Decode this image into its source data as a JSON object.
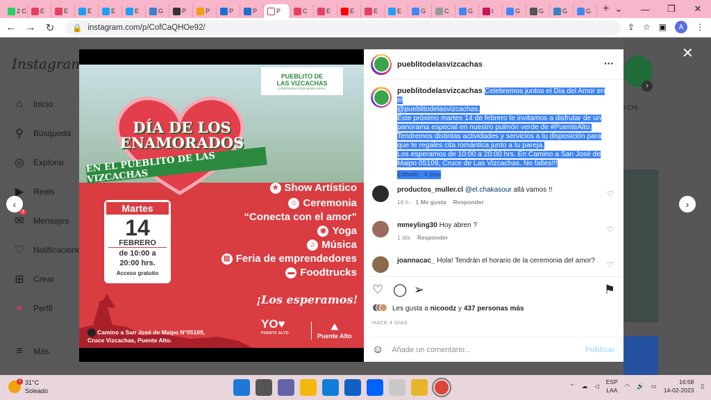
{
  "browser": {
    "tabs": [
      {
        "label": "2 C",
        "color": "#25d366"
      },
      {
        "label": "E",
        "color": "#e4405f"
      },
      {
        "label": "E",
        "color": "#e4405f"
      },
      {
        "label": "E",
        "color": "#1da1f2"
      },
      {
        "label": "E",
        "color": "#1da1f2"
      },
      {
        "label": "E",
        "color": "#1da1f2"
      },
      {
        "label": "G",
        "color": "#3b82c4"
      },
      {
        "label": "P",
        "color": "#333333"
      },
      {
        "label": "P",
        "color": "#f2a10c"
      },
      {
        "label": "P",
        "color": "#1a6fd0"
      },
      {
        "label": "P",
        "color": "#1a6fd0"
      },
      {
        "label": "P",
        "color": "#ffffff",
        "active": true
      },
      {
        "label": "C",
        "color": "#e4405f"
      },
      {
        "label": "E",
        "color": "#e4405f"
      },
      {
        "label": "E",
        "color": "#ff0000"
      },
      {
        "label": "E",
        "color": "#e4405f"
      },
      {
        "label": "E",
        "color": "#1da1f2"
      },
      {
        "label": "G",
        "color": "#4285f4"
      },
      {
        "label": "C",
        "color": "#999999"
      },
      {
        "label": "G",
        "color": "#4285f4"
      },
      {
        "label": "I",
        "color": "#c2185b"
      },
      {
        "label": "G",
        "color": "#4285f4"
      },
      {
        "label": "G",
        "color": "#555555"
      },
      {
        "label": "G",
        "color": "#3b82c4"
      },
      {
        "label": "G",
        "color": "#4285f4"
      }
    ],
    "url": "instagram.com/p/CofCaQHOe92/",
    "profile_initial": "A"
  },
  "sidebar": {
    "brand": "Instagram",
    "items": [
      {
        "label": "Inicio",
        "icon": "home-icon"
      },
      {
        "label": "Búsqueda",
        "icon": "search-icon"
      },
      {
        "label": "Explorar",
        "icon": "compass-icon"
      },
      {
        "label": "Reels",
        "icon": "reels-icon"
      },
      {
        "label": "Mensajes",
        "icon": "messenger-icon"
      },
      {
        "label": "Notificaciones",
        "icon": "heart-icon"
      },
      {
        "label": "Crear",
        "icon": "plus-square-icon"
      },
      {
        "label": "Perfil",
        "icon": "profile-icon"
      },
      {
        "label": "Más",
        "icon": "menu-icon"
      }
    ],
    "messages_badge": "3"
  },
  "poster": {
    "logo_line1": "PUEBLITO DE",
    "logo_line2": "LAS VIZCACHAS",
    "logo_line3": "CORPORACIÓN MUNICIPAL",
    "title": "DÍA DE LOS ENAMORADOS",
    "ribbon": "EN EL PUEBLITO DE LAS VIZCACHAS",
    "events": [
      "Show Artístico",
      "Ceremonia",
      "“Conecta con el amor”",
      "Yoga",
      "Música",
      "Feria de emprendedores",
      "Foodtrucks"
    ],
    "cal_head": "Martes",
    "cal_day": "14",
    "cal_month": "FEBRERO",
    "cal_time1": "de 10:00 a",
    "cal_time2": "20:00 hrs.",
    "cal_free": "Acceso gratuito",
    "esperamos": "¡Los esperamos!",
    "addr1": "Camino a San José de Maipo N°05109,",
    "addr2": "Cruce Vizcachas, Puente Alto.",
    "yo": "YO♥",
    "yo_sub": "PUENTE ALTO",
    "pa": "Puente Alto"
  },
  "post": {
    "username": "pueblitodelasvizcachas",
    "caption_l1": "Celebremos juntos el Día del Amor en el",
    "caption_l2": "@pueblitodelasvizcachas.",
    "caption_l3": "Este próximo martes 14 de febrero te invitamos a disfrutar de un",
    "caption_l4": "panorama especial en nuestro pulmón verde de #PuenteAlto.",
    "caption_l5": "Tendremos distintas actividades y servicios a tu disposición para",
    "caption_l6": "que te regales cita romántica junto a tu pareja.",
    "caption_l7": "Los esperamos de 10:00 a 20:00 hrs. En Camino a San José de",
    "caption_l8": "Maipo 05109, Cruce de Las Vizcachas. No faltes!!!",
    "edited": "Editado · 4 días",
    "comments": [
      {
        "user": "productos_muller.cl",
        "mention": "@el.chakasour",
        "text": " allá vamos !!",
        "time": "16 h",
        "likes": "1 Me gusta",
        "reply": "Responder",
        "color": "#2a2a2a"
      },
      {
        "user": "mmeyling30",
        "text": "Hoy abren ?",
        "time": "1 día",
        "reply": "Responder",
        "color": "#9a6b5d"
      },
      {
        "user": "joannacac_",
        "text": "Hola! Tendrán el horario de la ceremonia del amor?",
        "color": "#8a6b4d"
      }
    ],
    "likes_prefix": "Les gusta a ",
    "likes_user": "nicoodz",
    "likes_mid": " y ",
    "likes_count": "437 personas más",
    "ago": "HACE 4 DÍAS",
    "add_comment_placeholder": "Añade un comentario...",
    "publish": "Publicar"
  },
  "right_bg": {
    "label": "I CHI"
  },
  "taskbar": {
    "temp": "31°C",
    "weather": "Soleado",
    "weather_badge": "1",
    "lang1": "ESP",
    "lang2": "LAA",
    "time": "16:58",
    "date": "14-02-2023",
    "apps": [
      "#1e78d8",
      "#555555",
      "#6264a7",
      "#f2b90c",
      "#0f7ed8",
      "#1061c2",
      "#0061fe",
      "#c8c8c8",
      "#e8b52a",
      "#db4437"
    ]
  }
}
